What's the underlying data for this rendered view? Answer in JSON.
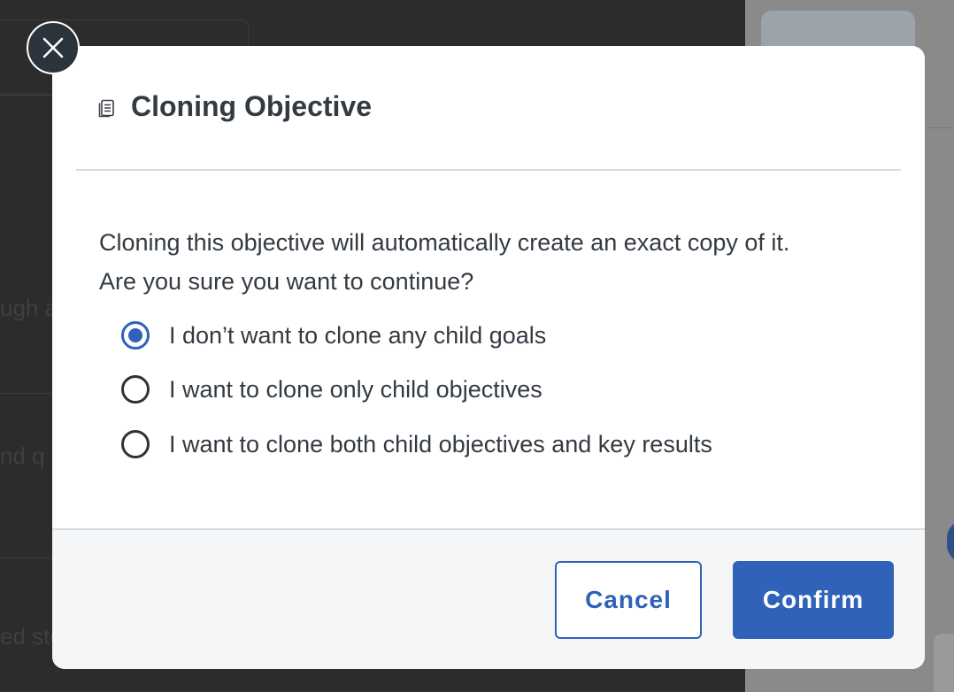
{
  "background": {
    "fragments": [
      "ugh a",
      "nd q",
      "ed sto"
    ]
  },
  "modal": {
    "title_icon": "copy-icon",
    "title": "Cloning Objective",
    "message_line1": "Cloning this objective will automatically create an exact copy of it.",
    "message_line2": "Are you sure you want to continue?",
    "options": [
      {
        "label": "I don’t want to clone any child goals",
        "selected": true
      },
      {
        "label": "I want to clone only child objectives",
        "selected": false
      },
      {
        "label": "I want to clone both child objectives and key results",
        "selected": false
      }
    ],
    "cancel_label": "Cancel",
    "confirm_label": "Confirm",
    "close_icon": "close-icon"
  },
  "colors": {
    "accent": "#2f62b8",
    "text": "#333a42",
    "footer_bg": "#f5f6f7",
    "overlay": "#2c2c2c"
  }
}
